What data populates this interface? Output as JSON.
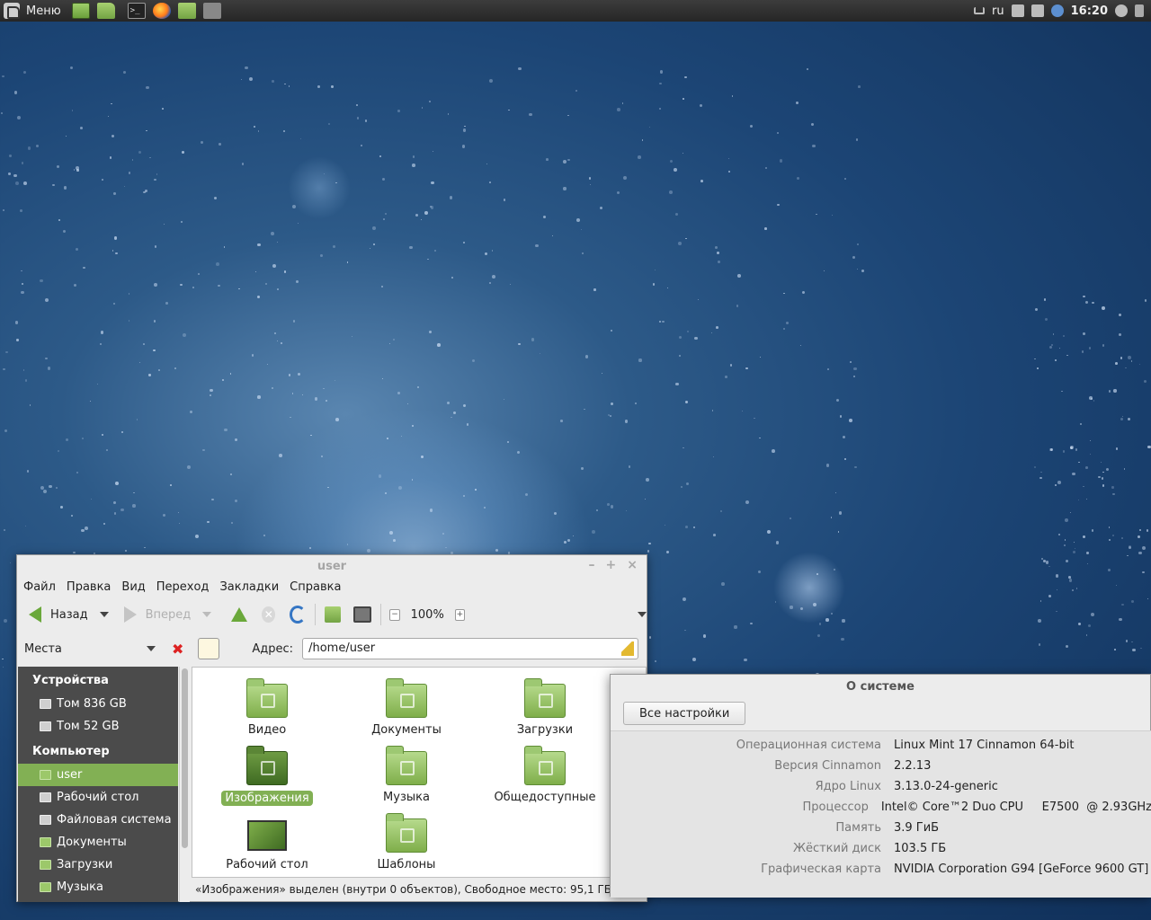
{
  "panel": {
    "menu_label": "Меню",
    "lang": "ru",
    "clock": "16:20"
  },
  "fm": {
    "title": "user",
    "window_controls": [
      "–",
      "+",
      "×"
    ],
    "menu": [
      "Файл",
      "Правка",
      "Вид",
      "Переход",
      "Закладки",
      "Справка"
    ],
    "toolbar": {
      "back": "Назад",
      "forward": "Вперед",
      "zoom": "100%"
    },
    "places_label": "Места",
    "address_label": "Адрес:",
    "address_value": "/home/user",
    "sidebar": {
      "devices_header": "Устройства",
      "devices": [
        "Том 836 GB",
        "Том 52 GB"
      ],
      "computer_header": "Компьютер",
      "computer": [
        "user",
        "Рабочий стол",
        "Файловая система",
        "Документы",
        "Загрузки",
        "Музыка"
      ]
    },
    "items": [
      "Видео",
      "Документы",
      "Загрузки",
      "Изображения",
      "Музыка",
      "Общедоступные",
      "Рабочий стол",
      "Шаблоны"
    ],
    "status": "«Изображения» выделен (внутри 0 объектов), Свободное место: 95,1 ГБ"
  },
  "sys": {
    "title": "О системе",
    "all_settings": "Все настройки",
    "rows": [
      {
        "key": "Операционная система",
        "value": "Linux Mint 17 Cinnamon 64-bit"
      },
      {
        "key": "Версия Cinnamon",
        "value": "2.2.13"
      },
      {
        "key": "Ядро Linux",
        "value": "3.13.0-24-generic"
      },
      {
        "key": "Процессор",
        "value": "Intel© Core™2 Duo CPU     E7500  @ 2.93GHz"
      },
      {
        "key": "Память",
        "value": "3.9 ГиБ"
      },
      {
        "key": "Жёсткий диск",
        "value": "103.5 ГБ"
      },
      {
        "key": "Графическая карта",
        "value": "NVIDIA Corporation G94 [GeForce 9600 GT]"
      }
    ]
  }
}
